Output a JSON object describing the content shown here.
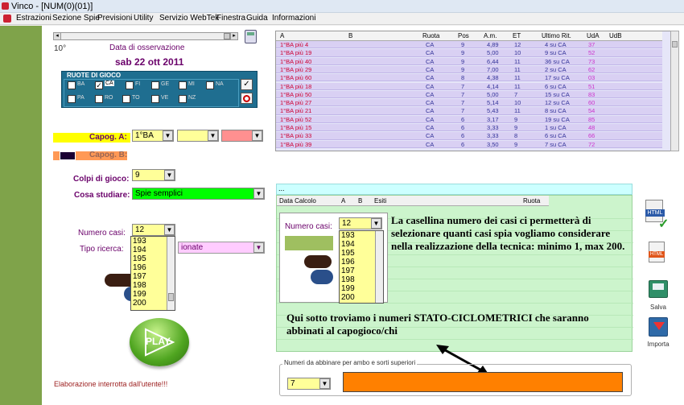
{
  "window": {
    "title": "Vinco - [NUM(0)(01)]"
  },
  "menu": [
    "Estrazioni",
    "Sezione Spie",
    "Previsioni",
    "Utility",
    "Servizio WebTek",
    "Finestra",
    "Guida",
    "Informazioni"
  ],
  "observation": {
    "index_label": "10°",
    "date_title": "Data di osservazione",
    "date_value": "sab 22 ott 2011"
  },
  "ruote": {
    "legend": "RUOTE DI GIOCO",
    "row1": [
      "BA",
      "CA",
      "FI",
      "GE",
      "MI",
      "NA"
    ],
    "row2": [
      "PA",
      "RO",
      "TO",
      "VE",
      "NZ"
    ]
  },
  "capogioco": {
    "a_label": "Capog. A:",
    "a_value": "1°BA",
    "b_label": "Capog. B:"
  },
  "colpi": {
    "label": "Colpi di gioco:",
    "value": "9"
  },
  "studiare": {
    "label": "Cosa studiare:",
    "value": "Spie semplici"
  },
  "numero_casi": {
    "label": "Numero casi:",
    "value": "12",
    "list": [
      "193",
      "194",
      "195",
      "196",
      "197",
      "198",
      "199",
      "200"
    ]
  },
  "tipo_ricerca": {
    "label": "Tipo ricerca:",
    "value_fragment": "ionate"
  },
  "play_label": "PLAY",
  "status_text": "Elaborazione interrotta dall'utente!!!",
  "table": {
    "headers": [
      "A",
      "B",
      "Ruota",
      "Pos",
      "A.m.",
      "ET",
      "Ultimo Rit.",
      "UdA",
      "UdB"
    ],
    "rows": [
      [
        "1°BA  più 4",
        "",
        "CA",
        "9",
        "4,89",
        "12",
        "4 su CA",
        "37",
        ""
      ],
      [
        "1°BA  più 19",
        "",
        "CA",
        "9",
        "5,00",
        "10",
        "9 su CA",
        "52",
        ""
      ],
      [
        "1°BA  più 40",
        "",
        "CA",
        "9",
        "6,44",
        "11",
        "36 su CA",
        "73",
        ""
      ],
      [
        "1°BA  più 29",
        "",
        "CA",
        "9",
        "7,00",
        "11",
        "2 su CA",
        "62",
        ""
      ],
      [
        "1°BA  più 60",
        "",
        "CA",
        "8",
        "4,38",
        "11",
        "17 su CA",
        "03",
        ""
      ],
      [
        "1°BA  più 18",
        "",
        "CA",
        "7",
        "4,14",
        "11",
        "6 su CA",
        "51",
        ""
      ],
      [
        "1°BA  più 50",
        "",
        "CA",
        "7",
        "5,00",
        "7",
        "15 su CA",
        "83",
        ""
      ],
      [
        "1°BA  più 27",
        "",
        "CA",
        "7",
        "5,14",
        "10",
        "12 su CA",
        "60",
        ""
      ],
      [
        "1°BA  più 21",
        "",
        "CA",
        "7",
        "5,43",
        "11",
        "8 su CA",
        "54",
        ""
      ],
      [
        "1°BA  più 52",
        "",
        "CA",
        "6",
        "3,17",
        "9",
        "19 su CA",
        "85",
        ""
      ],
      [
        "1°BA  più 15",
        "",
        "CA",
        "6",
        "3,33",
        "9",
        "1 su CA",
        "48",
        ""
      ],
      [
        "1°BA  più 33",
        "",
        "CA",
        "6",
        "3,33",
        "8",
        "6 su CA",
        "66",
        ""
      ],
      [
        "1°BA  più 39",
        "",
        "CA",
        "6",
        "3,50",
        "9",
        "7 su CA",
        "72",
        ""
      ]
    ]
  },
  "results_panel": {
    "header_dots": "...",
    "headers": [
      "Data Calcolo",
      "A",
      "B",
      "Esiti",
      "Ruota"
    ]
  },
  "annotations": {
    "top": "La casellina numero dei casi ci permetterà di selezionare quanti casi spia vogliamo considerare nella realizzazione della tecnica: minimo 1, max 200.",
    "bottom": "Qui sotto troviamo i numeri STATO-CICLOMETRICI che saranno abbinati al capogioco/chi"
  },
  "numeri_box": {
    "legend": "Numeri da abbinare per ambo e sorti superiori",
    "value": "7"
  },
  "right_icons": {
    "save_label": "Salva",
    "import_label": "Importa"
  },
  "colors": {
    "orange": "#ff8000",
    "purple": "#6a006a",
    "green_bg": "#ccf4cc",
    "table_row": "#d9d0f3"
  }
}
